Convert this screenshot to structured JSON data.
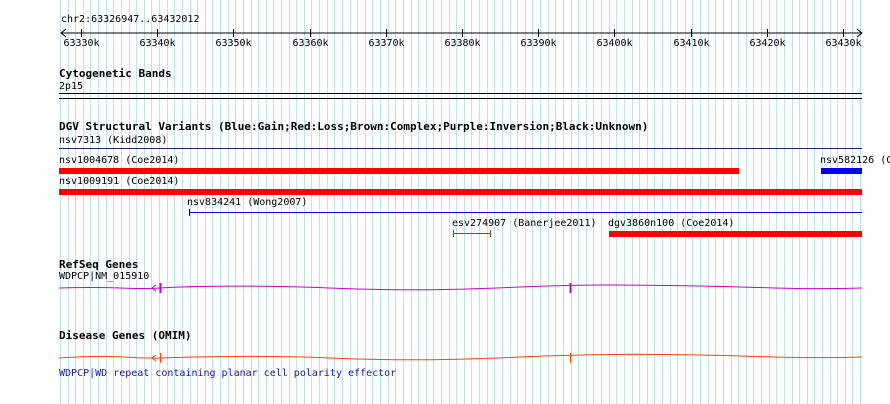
{
  "browser": {
    "location": "chr2:63326947..63432012",
    "ruler_ticks": [
      "63330k",
      "63340k",
      "63350k",
      "63360k",
      "63370k",
      "63380k",
      "63390k",
      "63400k",
      "63410k",
      "63420k",
      "63430k"
    ]
  },
  "tracks": {
    "cytoband": {
      "title": "Cytogenetic Bands",
      "band": "2p15"
    },
    "dgv": {
      "title": "DGV Structural Variants (Blue:Gain;Red:Loss;Brown:Complex;Purple:Inversion;Black:Unknown)",
      "features": [
        {
          "label": "nsv7313 (Kidd2008)",
          "type": "Unknown",
          "color": "#1e1e8c"
        },
        {
          "label": "nsv1004678 (Coe2014)",
          "type": "Loss",
          "color": "#ff0000"
        },
        {
          "label": "nsv582126 (C",
          "type": "Gain",
          "color": "#0000ee"
        },
        {
          "label": "nsv1009191 (Coe2014)",
          "type": "Loss",
          "color": "#ff0000"
        },
        {
          "label": "nsv834241 (Wong2007)",
          "type": "Gain",
          "color": "#0000ee"
        },
        {
          "label": "esv274907 (Banerjee2011)",
          "type": "Complex",
          "color": "#8b4513"
        },
        {
          "label": "dgv3860n100 (Coe2014)",
          "type": "Loss",
          "color": "#ff0000"
        }
      ]
    },
    "refseq": {
      "title": "RefSeq Genes",
      "gene_label": "WDPCP|NM_015910",
      "color": "#cc00cc"
    },
    "disease": {
      "title": "Disease Genes (OMIM)",
      "gene_label": "WDPCP|WD repeat containing planar cell polarity effector",
      "color": "#ff4500"
    }
  }
}
